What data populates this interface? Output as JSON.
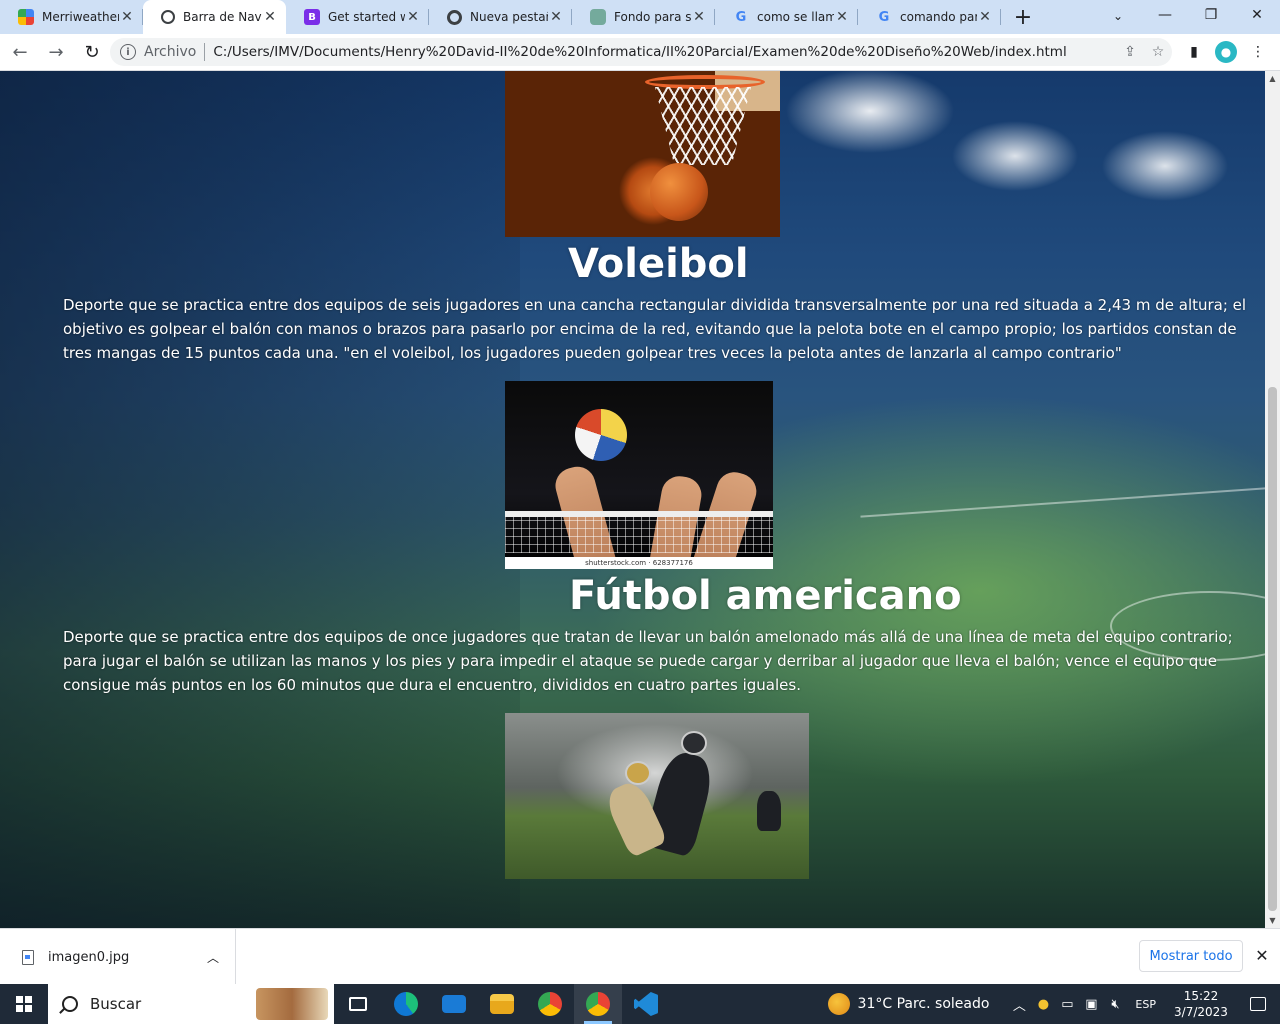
{
  "browser": {
    "tabs": [
      {
        "title": "Merriweather -",
        "favicon": "google-fonts-icon",
        "active": false
      },
      {
        "title": "Barra de Naveg",
        "favicon": "globe-icon",
        "active": true
      },
      {
        "title": "Get started wit",
        "favicon": "bootstrap-icon",
        "active": false
      },
      {
        "title": "Nueva pestaña",
        "favicon": "chrome-icon",
        "active": false
      },
      {
        "title": "Fondo para siti",
        "favicon": "chatgpt-icon",
        "active": false
      },
      {
        "title": "como se llama",
        "favicon": "google-icon",
        "active": false
      },
      {
        "title": "comando para",
        "favicon": "google-icon",
        "active": false
      }
    ],
    "omnibox": {
      "scheme": "Archivo",
      "url": "C:/Users/IMV/Documents/Henry%20David-II%20de%20Informatica/II%20Parcial/Examen%20de%20Diseño%20Web/index.html"
    }
  },
  "page": {
    "sections": [
      {
        "title": "Voleibol",
        "description": "Deporte que se practica entre dos equipos de seis jugadores en una cancha rectangular dividida transversalmente por una red situada a 2,43 m de altura; el objetivo es golpear el balón con manos o brazos para pasarlo por encima de la red, evitando que la pelota bote en el campo propio; los partidos constan de tres mangas de 15 puntos cada una. \"en el voleibol, los jugadores pueden golpear tres veces la pelota antes de lanzarla al campo contrario\""
      },
      {
        "title": "Fútbol americano",
        "description": "Deporte que se practica entre dos equipos de once jugadores que tratan de llevar un balón amelonado más allá de una línea de meta del equipo contrario; para jugar el balón se utilizan las manos y los pies y para impedir el ataque se puede cargar y derribar al jugador que lleva el balón; vence el equipo que consigue más puntos en los 60 minutos que dura el encuentro, divididos en cuatro partes iguales."
      }
    ],
    "volley_image_credit": "shutterstock.com · 628377176"
  },
  "downloads": {
    "file_name": "imagen0.jpg",
    "show_all": "Mostrar todo"
  },
  "taskbar": {
    "search_label": "Buscar",
    "weather": "31°C  Parc. soleado",
    "language": "ESP",
    "time": "15:22",
    "date": "3/7/2023"
  }
}
